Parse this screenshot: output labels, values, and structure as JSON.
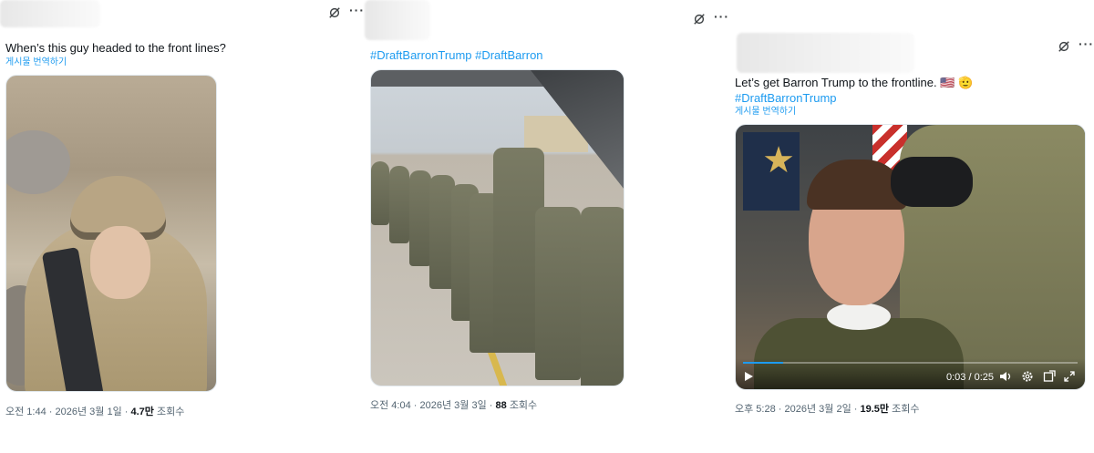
{
  "posts": [
    {
      "text": "When’s this guy headed to the front lines?",
      "translate": "게시물 번역하기",
      "time": "오전 1:44",
      "date": "2026년 3월 1일",
      "views": "4.7만",
      "views_label": "조회수",
      "icons": [
        "grok-icon",
        "more-icon"
      ]
    },
    {
      "hashtags": "#DraftBarronTrump #DraftBarron",
      "time": "오전 4:04",
      "date": "2026년 3월 3일",
      "views": "88",
      "views_label": "조회수",
      "icons": [
        "grok-icon",
        "more-icon"
      ]
    },
    {
      "text": "Let’s get Barron Trump to the frontline. 🇺🇸 🫡",
      "hashtags": "#DraftBarronTrump",
      "translate": "게시물 번역하기",
      "time": "오후 5:28",
      "date": "2026년 3월 2일",
      "views": "19.5만",
      "views_label": "조회수",
      "video": {
        "current": "0:03",
        "separator": "/",
        "duration": "0:25",
        "progress": 0.12
      },
      "icons": [
        "grok-icon",
        "more-icon"
      ]
    }
  ],
  "more_glyph": "···",
  "meta_sep": "·",
  "colors": {
    "link": "#1d9bf0",
    "muted": "#536471",
    "text": "#0f1419"
  }
}
